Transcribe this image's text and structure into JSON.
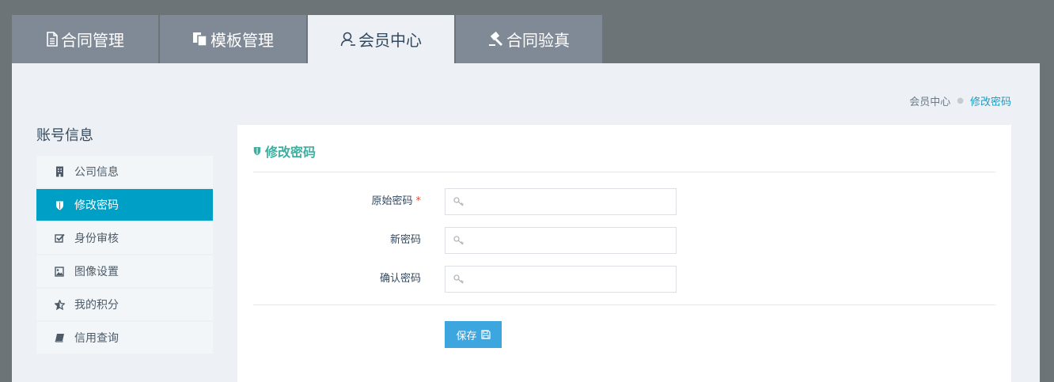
{
  "top_tabs": [
    {
      "label": "合同管理",
      "icon": "document-icon"
    },
    {
      "label": "模板管理",
      "icon": "copy-icon"
    },
    {
      "label": "会员中心",
      "icon": "user-icon",
      "active": true
    },
    {
      "label": "合同验真",
      "icon": "gavel-icon"
    }
  ],
  "breadcrumb": {
    "parent": "会员中心",
    "current": "修改密码"
  },
  "sidebar": {
    "title": "账号信息",
    "items": [
      {
        "label": "公司信息",
        "icon": "building-icon"
      },
      {
        "label": "修改密码",
        "icon": "shield-icon",
        "active": true
      },
      {
        "label": "身份审核",
        "icon": "checkbox-icon"
      },
      {
        "label": "图像设置",
        "icon": "image-icon"
      },
      {
        "label": "我的积分",
        "icon": "star-icon"
      },
      {
        "label": "信用查询",
        "icon": "book-icon"
      }
    ]
  },
  "form": {
    "title": "修改密码",
    "fields": [
      {
        "label": "原始密码",
        "required_mark": "*",
        "value": ""
      },
      {
        "label": "新密码",
        "value": ""
      },
      {
        "label": "确认密码",
        "value": ""
      }
    ],
    "save_label": "保存"
  },
  "colors": {
    "background": "#6d7478",
    "tab_inactive": "#7f8a96",
    "panel": "#edf1f6",
    "sidebar_active": "#00a0c6",
    "title_accent": "#3fae9e",
    "breadcrumb_current": "#1a9cc4",
    "save_button": "#3ea6de",
    "required": "#e2473c"
  }
}
